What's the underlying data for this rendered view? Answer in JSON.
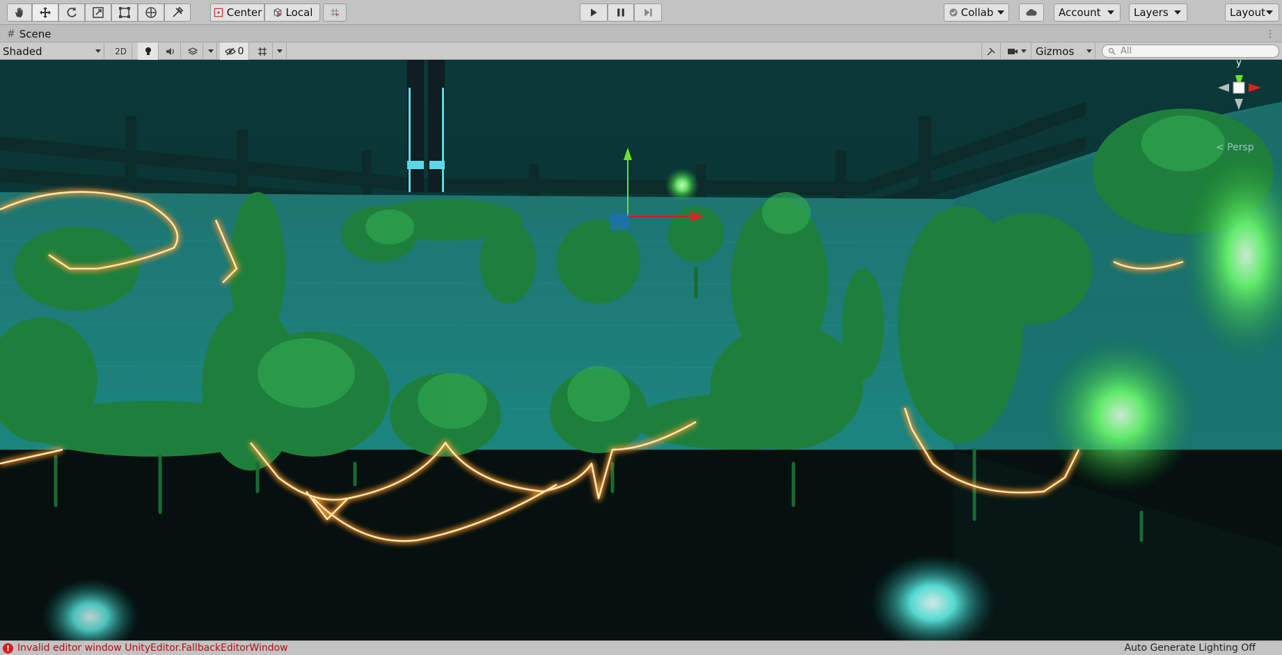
{
  "toolbar": {
    "tools": [
      "hand-tool-icon",
      "move-tool-icon",
      "rotate-tool-icon",
      "scale-tool-icon",
      "rect-tool-icon",
      "transform-tool-icon",
      "custom-tool-icon"
    ],
    "pivot_label": "Center",
    "space_label": "Local",
    "collab_label": "Collab",
    "account_label": "Account",
    "layers_label": "Layers",
    "layout_label": "Layout"
  },
  "scene_tab": {
    "label": "Scene"
  },
  "scene_toolbar": {
    "draw_mode": "Shaded",
    "mode_2d": "2D",
    "hidden_count": "0",
    "gizmos_label": "Gizmos",
    "search_placeholder": "All"
  },
  "viewport": {
    "gizmo_axis_label": "y",
    "projection_label": "< Persp"
  },
  "status_bar": {
    "error_message": "Invalid editor window UnityEditor.FallbackEditorWindow",
    "lighting_message": "Auto Generate Lighting Off"
  }
}
